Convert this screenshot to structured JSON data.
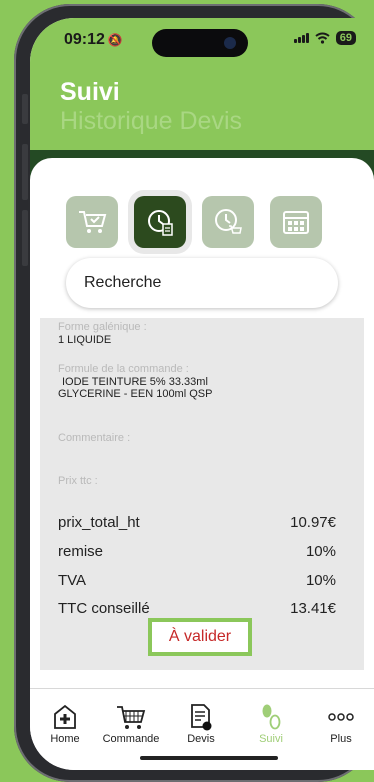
{
  "status": {
    "time": "09:12",
    "battery": "69"
  },
  "header": {
    "title": "Suivi",
    "subtitle": "Historique Devis"
  },
  "icons": [
    "cart-check-icon",
    "clock-document-icon",
    "clock-cart-icon",
    "calendar-grid-icon"
  ],
  "search": {
    "placeholder": "Recherche"
  },
  "detail": {
    "forme_label": "Forme galénique :",
    "forme_value": "1 LIQUIDE",
    "formule_label": "Formule de la commande :",
    "formule_line1": "IODE TEINTURE 5% 33.33ml",
    "formule_line2": "GLYCERINE - EEN 100ml QSP",
    "commentaire_label": "Commentaire :",
    "prix_label": "Prix ttc :",
    "rows": [
      {
        "label": "prix_total_ht",
        "value": "10.97€"
      },
      {
        "label": "remise",
        "value": "10%"
      },
      {
        "label": "TVA",
        "value": "10%"
      },
      {
        "label": "TTC conseillé",
        "value": "13.41€"
      }
    ],
    "status_button": "À valider"
  },
  "tabs": [
    {
      "label": "Home",
      "icon": "medical-house-icon"
    },
    {
      "label": "Commande",
      "icon": "cart-icon"
    },
    {
      "label": "Devis",
      "icon": "document-icon"
    },
    {
      "label": "Suivi",
      "icon": "footsteps-icon",
      "active": true
    },
    {
      "label": "Plus",
      "icon": "more-icon"
    }
  ],
  "colors": {
    "accent": "#8bc75a",
    "dark": "#2c4a1e",
    "alert": "#c62828"
  }
}
